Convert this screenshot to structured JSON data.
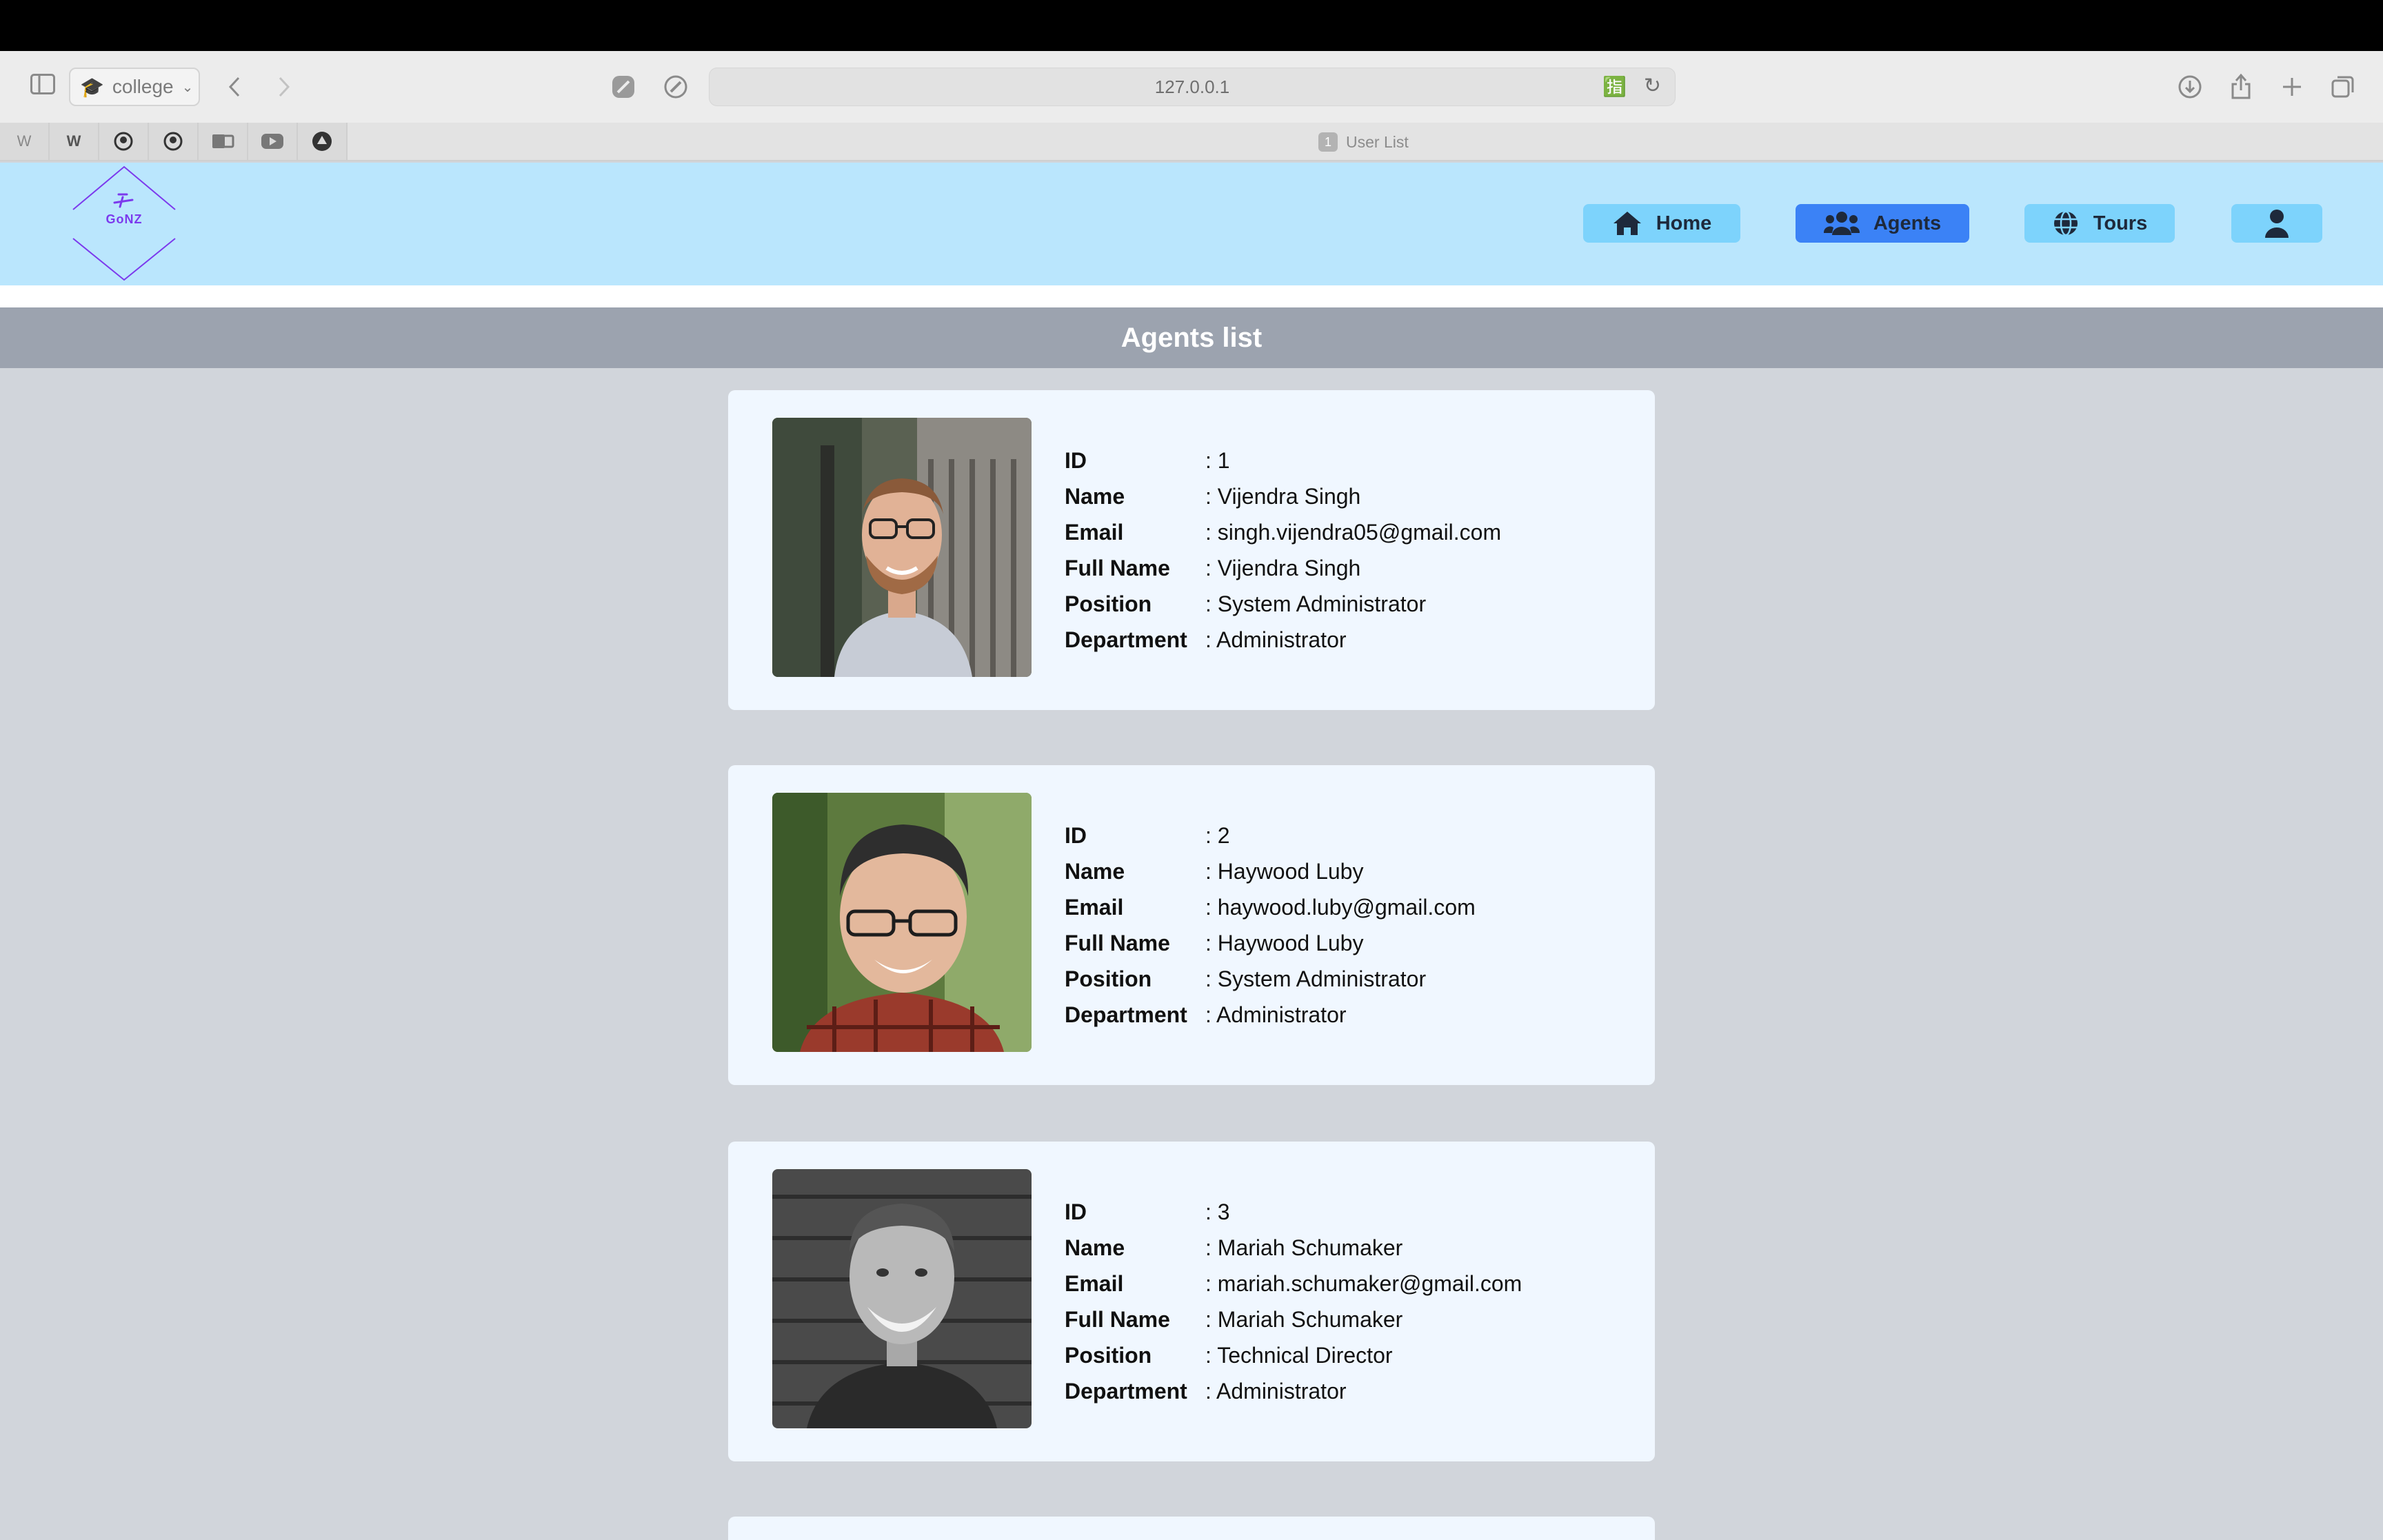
{
  "browser": {
    "profile": "college",
    "url": "127.0.0.1",
    "tab": {
      "number": "1",
      "title": "User List"
    },
    "favorites": [
      "wikipedia-icon",
      "wix-icon",
      "github-icon",
      "github-icon",
      "outlook-icon",
      "youtube-icon",
      "up-arrow-icon"
    ]
  },
  "site": {
    "logo_text": "GoNZ",
    "nav": [
      {
        "label": "Home",
        "icon": "home-icon",
        "active": false
      },
      {
        "label": "Agents",
        "icon": "users-icon",
        "active": true
      },
      {
        "label": "Tours",
        "icon": "globe-icon",
        "active": false
      },
      {
        "label": "",
        "icon": "user-icon",
        "active": false
      }
    ],
    "colors": {
      "header_bg": "#bae6fd",
      "nav_bg": "#7dd3fc",
      "nav_active": "#3b82f6",
      "list_header_bg": "#9ca3af",
      "card_bg": "#f0f7ff"
    }
  },
  "page": {
    "title": "Agents list",
    "field_labels": [
      "ID",
      "Name",
      "Email",
      "Full Name",
      "Position",
      "Department"
    ],
    "agents": [
      {
        "id": "1",
        "name": "Vijendra Singh",
        "email": "singh.vijendra05@gmail.com",
        "full_name": "Vijendra Singh",
        "position": "System Administrator",
        "department": "Administrator"
      },
      {
        "id": "2",
        "name": "Haywood Luby",
        "email": "haywood.luby@gmail.com",
        "full_name": "Haywood Luby",
        "position": "System Administrator",
        "department": "Administrator"
      },
      {
        "id": "3",
        "name": "Mariah Schumaker",
        "email": "mariah.schumaker@gmail.com",
        "full_name": "Mariah Schumaker",
        "position": "Technical Director",
        "department": "Administrator"
      }
    ]
  }
}
